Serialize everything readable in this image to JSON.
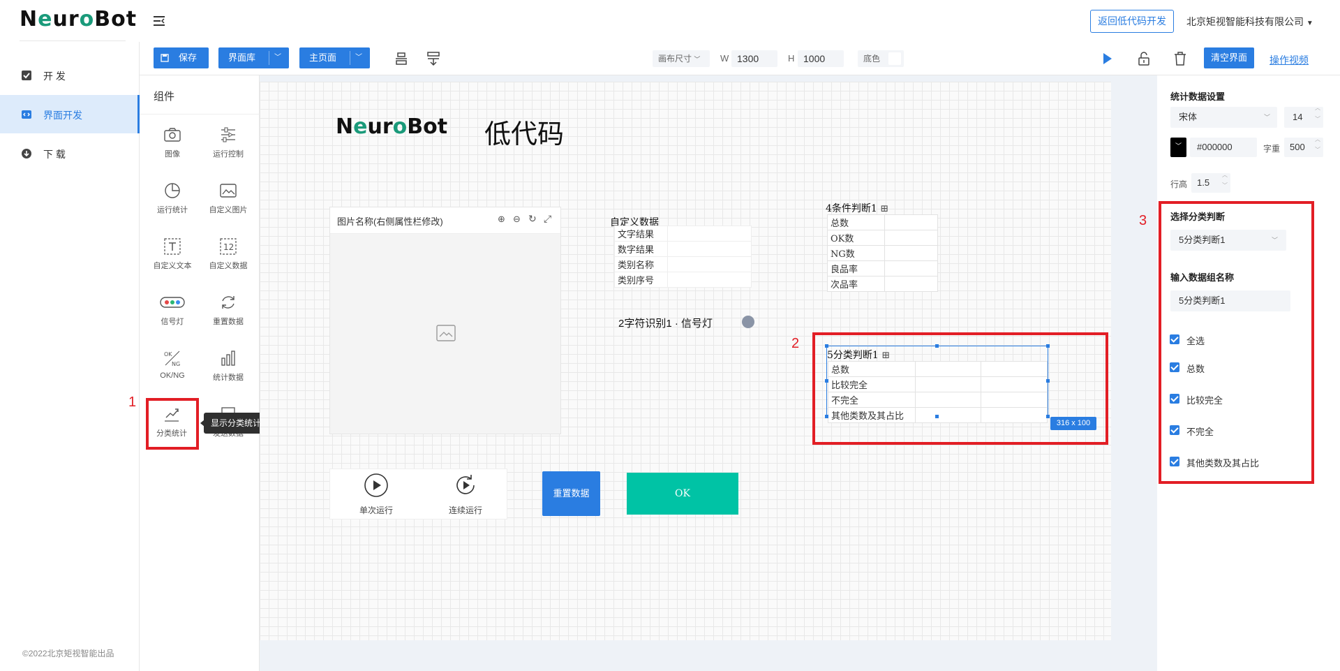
{
  "app": {
    "logo": "NeuroBot",
    "back_button": "返回低代码开发",
    "company": "北京矩视智能科技有限公司",
    "copyright": "©2022北京矩视智能出品"
  },
  "sidebar": {
    "items": [
      {
        "label": "开 发",
        "icon": "checkbox-icon"
      },
      {
        "label": "界面开发",
        "icon": "code-icon",
        "active": true
      },
      {
        "label": "下 载",
        "icon": "download-icon"
      }
    ]
  },
  "toolbar": {
    "save": "保存",
    "library": "界面库",
    "main_page": "主页面",
    "canvas_size_label": "画布尺寸",
    "w_label": "W",
    "w_value": "1300",
    "h_label": "H",
    "h_value": "1000",
    "bg_label": "底色",
    "clear": "清空界面",
    "video": "操作视频"
  },
  "components": {
    "title": "组件",
    "items": [
      "图像",
      "运行控制",
      "运行统计",
      "自定义图片",
      "自定义文本",
      "自定义数据",
      "信号灯",
      "重置数据",
      "OK/NG",
      "统计数据",
      "分类统计",
      "发送数据"
    ],
    "tooltip": "显示分类统计相关计数信息"
  },
  "canvas": {
    "logo": "NeuroBot",
    "heading": "低代码",
    "image_panel_title": "图片名称(右侧属性栏修改)",
    "custom_data": {
      "title": "自定义数据",
      "rows": [
        "文字结果",
        "数字结果",
        "类别名称",
        "类别序号"
      ]
    },
    "cond4": {
      "title": "4条件判断1",
      "rows": [
        "总数",
        "OK数",
        "NG数",
        "良品率",
        "次品率"
      ]
    },
    "signal": "2字符识别1 · 信号灯",
    "class5": {
      "title": "5分类判断1",
      "rows": [
        "总数",
        "比较完全",
        "不完全",
        "其他类数及其占比"
      ],
      "size_badge": "316 x 100"
    },
    "run_once": "单次运行",
    "run_continuous": "连续运行",
    "reset_button": "重置数据",
    "ok_button": "OK"
  },
  "right_panel": {
    "title": "统计数据设置",
    "font": "宋体",
    "font_size": "14",
    "color": "#000000",
    "weight_label": "字重",
    "weight": "500",
    "line_height_label": "行高",
    "line_height": "1.5",
    "select_label": "选择分类判断",
    "select_value": "5分类判断1",
    "group_label": "输入数据组名称",
    "group_value": "5分类判断1",
    "checkboxes": [
      "全选",
      "总数",
      "比较完全",
      "不完全",
      "其他类数及其占比"
    ]
  },
  "annotations": [
    "1",
    "2",
    "3"
  ],
  "colors": {
    "accent": "#2a7de1",
    "ok": "#00c3a5",
    "annotation": "#e21e25"
  }
}
